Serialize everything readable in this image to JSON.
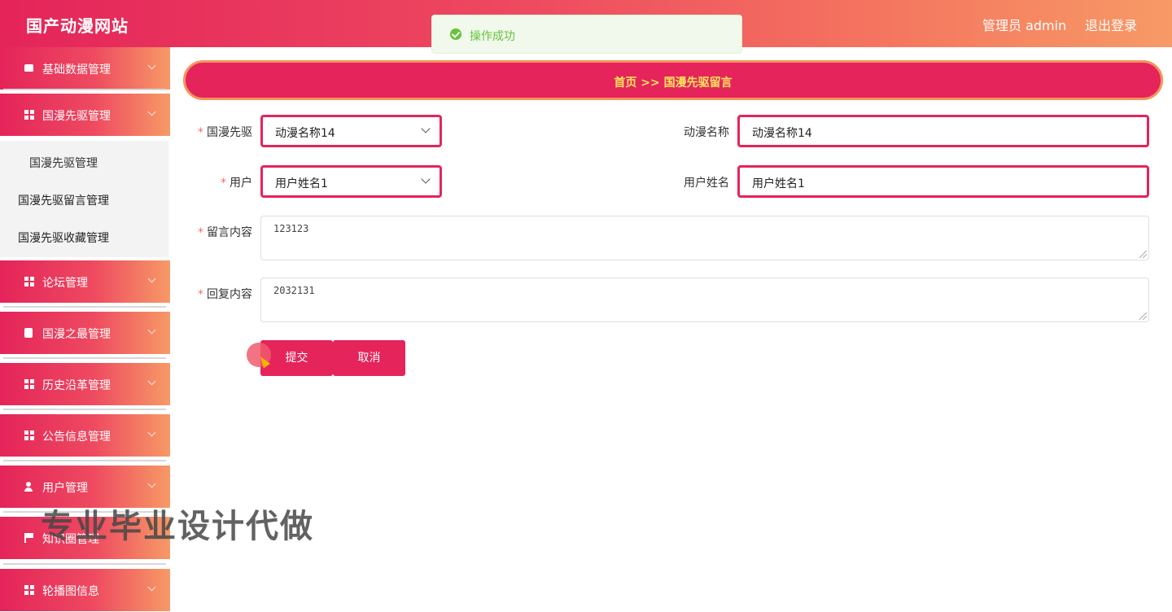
{
  "header": {
    "title": "国产动漫网站",
    "user": "管理员 admin",
    "logout": "退出登录"
  },
  "toast": {
    "message": "操作成功"
  },
  "sidebar": {
    "items": [
      {
        "label": "基础数据管理",
        "icon": "thumb-icon"
      },
      {
        "label": "国漫先驱管理",
        "icon": "grid-icon"
      },
      {
        "label": "论坛管理",
        "icon": "grid-icon"
      },
      {
        "label": "国漫之最管理",
        "icon": "clipboard-icon"
      },
      {
        "label": "历史沿革管理",
        "icon": "grid-icon"
      },
      {
        "label": "公告信息管理",
        "icon": "grid-icon"
      },
      {
        "label": "用户管理",
        "icon": "person-icon"
      },
      {
        "label": "知识圈管理",
        "icon": "flag-icon"
      },
      {
        "label": "轮播图信息",
        "icon": "grid-icon"
      }
    ],
    "submenu": [
      "国漫先驱管理",
      "国漫先驱留言管理",
      "国漫先驱收藏管理"
    ]
  },
  "breadcrumb": {
    "text": "首页  >>  国漫先驱留言"
  },
  "form": {
    "pioneer_label": "国漫先驱",
    "pioneer_value": "动漫名称14",
    "anime_name_label": "动漫名称",
    "anime_name_value": "动漫名称14",
    "user_label": "用户",
    "user_value": "用户姓名1",
    "user_name_label": "用户姓名",
    "user_name_value": "用户姓名1",
    "message_label": "留言内容",
    "message_value": "123123",
    "reply_label": "回复内容",
    "reply_value": "2032131",
    "submit": "提交",
    "cancel": "取消"
  },
  "watermark": "专业毕业设计代做"
}
